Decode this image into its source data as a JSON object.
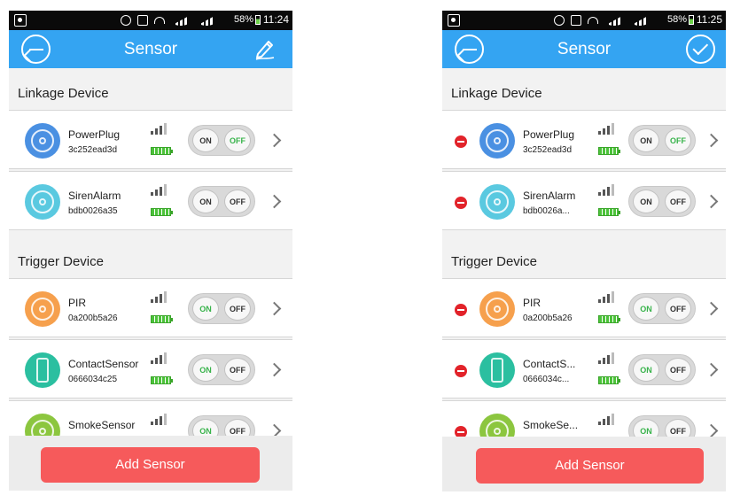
{
  "screens": [
    {
      "status": {
        "battery": "58%",
        "time": "11:24"
      },
      "title": "Sensor",
      "mode": "view",
      "linkage_label": "Linkage Device",
      "trigger_label": "Trigger Device",
      "add_label": "Add Sensor",
      "linkage": [
        {
          "name": "PowerPlug",
          "id": "3c252ead3d",
          "on": "ON",
          "off": "OFF",
          "active": "off",
          "color": "#4a90e2"
        },
        {
          "name": "SirenAlarm",
          "id": "bdb0026a35",
          "on": "ON",
          "off": "OFF",
          "active": "none",
          "color": "#5ac9e0"
        }
      ],
      "trigger": [
        {
          "name": "PIR",
          "id": "0a200b5a26",
          "on": "ON",
          "off": "OFF",
          "active": "on",
          "color": "#f6a04d"
        },
        {
          "name": "ContactSensor",
          "id": "0666034c25",
          "on": "ON",
          "off": "OFF",
          "active": "on",
          "color": "#2bbfa0"
        },
        {
          "name": "SmokeSensor",
          "id": "",
          "on": "ON",
          "off": "OFF",
          "active": "on",
          "color": "#8cc63f"
        }
      ]
    },
    {
      "status": {
        "battery": "58%",
        "time": "11:25"
      },
      "title": "Sensor",
      "mode": "edit",
      "linkage_label": "Linkage Device",
      "trigger_label": "Trigger Device",
      "add_label": "Add Sensor",
      "linkage": [
        {
          "name": "PowerPlug",
          "id": "3c252ead3d",
          "on": "ON",
          "off": "OFF",
          "active": "off",
          "color": "#4a90e2"
        },
        {
          "name": "SirenAlarm",
          "id": "bdb0026a...",
          "on": "ON",
          "off": "OFF",
          "active": "none",
          "color": "#5ac9e0"
        }
      ],
      "trigger": [
        {
          "name": "PIR",
          "id": "0a200b5a26",
          "on": "ON",
          "off": "OFF",
          "active": "on",
          "color": "#f6a04d"
        },
        {
          "name": "ContactS...",
          "id": "0666034c...",
          "on": "ON",
          "off": "OFF",
          "active": "on",
          "color": "#2bbfa0"
        },
        {
          "name": "SmokeSe...",
          "id": "",
          "on": "ON",
          "off": "OFF",
          "active": "on",
          "color": "#8cc63f"
        }
      ]
    }
  ],
  "icons": {
    "back": "back-arrow-icon",
    "edit": "pencil-icon",
    "done": "check-icon",
    "remove": "minus-circle-icon",
    "chevron": "chevron-right-icon",
    "signal": "signal-strength-icon",
    "battery": "battery-icon"
  },
  "colors": {
    "header": "#34a4f2",
    "add_button": "#f65a5b",
    "remove": "#e2232a",
    "switch_active": "#37b34a"
  }
}
